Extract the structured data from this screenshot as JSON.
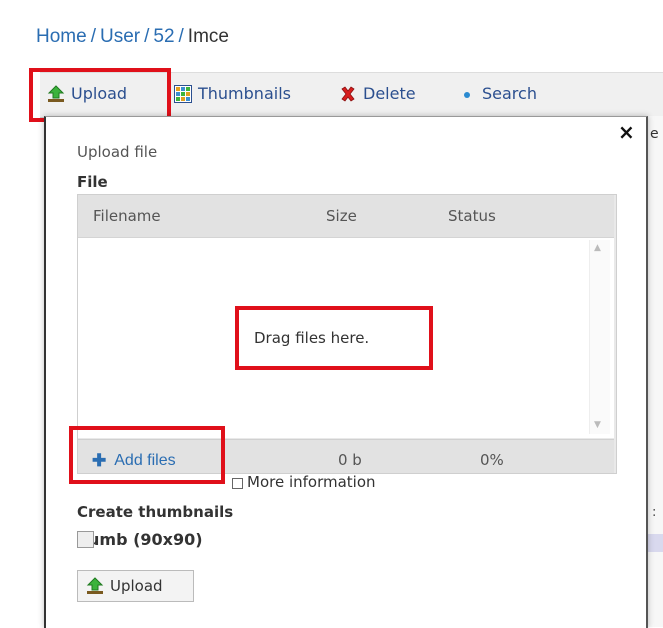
{
  "breadcrumb": {
    "items": [
      "Home",
      "User",
      "52"
    ],
    "separator": "/",
    "current": "Imce"
  },
  "toolbar": {
    "upload_label": "Upload",
    "thumbnails_label": "Thumbnails",
    "delete_label": "Delete",
    "search_label": "Search",
    "upload_icon": "upload-arrow-icon",
    "thumbnails_icon": "grid-icon",
    "delete_icon": "red-x-icon",
    "search_icon": "blue-dot-icon"
  },
  "dialog": {
    "close_glyph": "×",
    "title": "Upload file",
    "file_label": "File",
    "columns": [
      "Filename",
      "Size",
      "Status"
    ],
    "drop_text": "Drag files here.",
    "add_files_label": "Add files",
    "total_size": "0 b",
    "total_percent": "0%",
    "more_info_label": "More information",
    "create_thumbnails_label": "Create thumbnails",
    "thumb_option_label": "umb (90x90)",
    "upload_button_label": "Upload"
  },
  "side_strip": {
    "partial_text": "e",
    "colon": ":"
  },
  "colors": {
    "link_blue": "#2a6db2",
    "highlight_red": "#e0101a",
    "toolbar_bg": "#f0f0f0",
    "uploader_bg": "#e2e2e2"
  }
}
